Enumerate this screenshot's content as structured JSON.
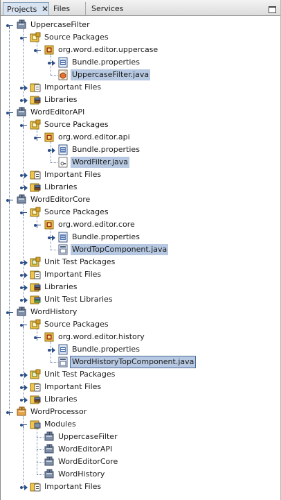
{
  "tabs": [
    {
      "label": "Projects",
      "active": true
    },
    {
      "label": "Files",
      "active": false
    },
    {
      "label": "Services",
      "active": false
    }
  ],
  "tab_close_glyph": "✕",
  "tree": [
    {
      "label": "UppercaseFilter",
      "depth": 0,
      "icon": "module-icon",
      "expander": "open",
      "selected": false
    },
    {
      "label": "Source Packages",
      "depth": 1,
      "icon": "source-packages-icon",
      "expander": "open",
      "selected": false
    },
    {
      "label": "org.word.editor.uppercase",
      "depth": 2,
      "icon": "package-icon",
      "expander": "open",
      "selected": false
    },
    {
      "label": "Bundle.properties",
      "depth": 3,
      "icon": "properties-file-icon",
      "expander": "closed",
      "selected": false
    },
    {
      "label": "UppercaseFilter.java",
      "depth": 3,
      "icon": "java-class-icon",
      "expander": "none",
      "selected": true
    },
    {
      "label": "Important Files",
      "depth": 1,
      "icon": "important-files-icon",
      "expander": "closed",
      "selected": false
    },
    {
      "label": "Libraries",
      "depth": 1,
      "icon": "libraries-icon",
      "expander": "closed",
      "selected": false
    },
    {
      "label": "WordEditorAPI",
      "depth": 0,
      "icon": "module-icon",
      "expander": "open",
      "selected": false
    },
    {
      "label": "Source Packages",
      "depth": 1,
      "icon": "source-packages-icon",
      "expander": "open",
      "selected": false
    },
    {
      "label": "org.word.editor.api",
      "depth": 2,
      "icon": "package-icon",
      "expander": "open",
      "selected": false
    },
    {
      "label": "Bundle.properties",
      "depth": 3,
      "icon": "properties-file-icon",
      "expander": "closed",
      "selected": false
    },
    {
      "label": "WordFilter.java",
      "depth": 3,
      "icon": "java-interface-icon",
      "expander": "none",
      "selected": true
    },
    {
      "label": "Important Files",
      "depth": 1,
      "icon": "important-files-icon",
      "expander": "closed",
      "selected": false
    },
    {
      "label": "Libraries",
      "depth": 1,
      "icon": "libraries-icon",
      "expander": "closed",
      "selected": false
    },
    {
      "label": "WordEditorCore",
      "depth": 0,
      "icon": "module-icon",
      "expander": "open",
      "selected": false
    },
    {
      "label": "Source Packages",
      "depth": 1,
      "icon": "source-packages-icon",
      "expander": "open",
      "selected": false
    },
    {
      "label": "org.word.editor.core",
      "depth": 2,
      "icon": "package-icon",
      "expander": "open",
      "selected": false
    },
    {
      "label": "Bundle.properties",
      "depth": 3,
      "icon": "properties-file-icon",
      "expander": "closed",
      "selected": false
    },
    {
      "label": "WordTopComponent.java",
      "depth": 3,
      "icon": "form-class-icon",
      "expander": "none",
      "selected": true
    },
    {
      "label": "Unit Test Packages",
      "depth": 1,
      "icon": "test-packages-icon",
      "expander": "closed",
      "selected": false
    },
    {
      "label": "Important Files",
      "depth": 1,
      "icon": "important-files-icon",
      "expander": "closed",
      "selected": false
    },
    {
      "label": "Libraries",
      "depth": 1,
      "icon": "libraries-icon",
      "expander": "closed",
      "selected": false
    },
    {
      "label": "Unit Test Libraries",
      "depth": 1,
      "icon": "test-libraries-icon",
      "expander": "closed",
      "selected": false
    },
    {
      "label": "WordHistory",
      "depth": 0,
      "icon": "module-icon",
      "expander": "open",
      "selected": false
    },
    {
      "label": "Source Packages",
      "depth": 1,
      "icon": "source-packages-icon",
      "expander": "open",
      "selected": false
    },
    {
      "label": "org.word.editor.history",
      "depth": 2,
      "icon": "package-icon",
      "expander": "open",
      "selected": false
    },
    {
      "label": "Bundle.properties",
      "depth": 3,
      "icon": "properties-file-icon",
      "expander": "closed",
      "selected": false
    },
    {
      "label": "WordHistoryTopComponent.java",
      "depth": 3,
      "icon": "form-class-icon",
      "expander": "none",
      "selected": true,
      "focused": true
    },
    {
      "label": "Unit Test Packages",
      "depth": 1,
      "icon": "test-packages-icon",
      "expander": "closed",
      "selected": false
    },
    {
      "label": "Important Files",
      "depth": 1,
      "icon": "important-files-icon",
      "expander": "closed",
      "selected": false
    },
    {
      "label": "Libraries",
      "depth": 1,
      "icon": "libraries-icon",
      "expander": "closed",
      "selected": false
    },
    {
      "label": "WordProcessor",
      "depth": 0,
      "icon": "suite-icon",
      "expander": "open",
      "selected": false
    },
    {
      "label": "Modules",
      "depth": 1,
      "icon": "modules-folder-icon",
      "expander": "open",
      "selected": false
    },
    {
      "label": "UppercaseFilter",
      "depth": 2,
      "icon": "module-icon",
      "expander": "none",
      "selected": false
    },
    {
      "label": "WordEditorAPI",
      "depth": 2,
      "icon": "module-icon",
      "expander": "none",
      "selected": false
    },
    {
      "label": "WordEditorCore",
      "depth": 2,
      "icon": "module-icon",
      "expander": "none",
      "selected": false
    },
    {
      "label": "WordHistory",
      "depth": 2,
      "icon": "module-icon",
      "expander": "none",
      "selected": false
    },
    {
      "label": "Important Files",
      "depth": 1,
      "icon": "important-files-icon",
      "expander": "closed",
      "selected": false
    }
  ]
}
